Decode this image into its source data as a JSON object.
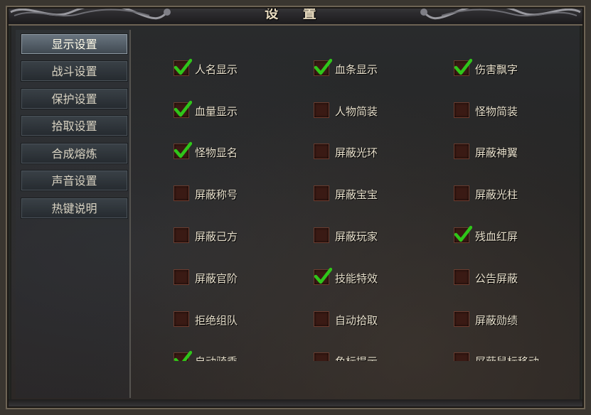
{
  "window": {
    "title": "设 置"
  },
  "tabs": [
    {
      "label": "显示设置",
      "active": true
    },
    {
      "label": "战斗设置",
      "active": false
    },
    {
      "label": "保护设置",
      "active": false
    },
    {
      "label": "拾取设置",
      "active": false
    },
    {
      "label": "合成熔炼",
      "active": false
    },
    {
      "label": "声音设置",
      "active": false
    },
    {
      "label": "热键说明",
      "active": false
    }
  ],
  "options": [
    [
      {
        "label": "人名显示",
        "checked": true
      },
      {
        "label": "血条显示",
        "checked": true
      },
      {
        "label": "伤害飘字",
        "checked": true
      }
    ],
    [
      {
        "label": "血量显示",
        "checked": true
      },
      {
        "label": "人物简装",
        "checked": false
      },
      {
        "label": "怪物简装",
        "checked": false
      }
    ],
    [
      {
        "label": "怪物显名",
        "checked": true
      },
      {
        "label": "屏蔽光环",
        "checked": false
      },
      {
        "label": "屏蔽神翼",
        "checked": false
      }
    ],
    [
      {
        "label": "屏蔽称号",
        "checked": false
      },
      {
        "label": "屏蔽宝宝",
        "checked": false
      },
      {
        "label": "屏蔽光柱",
        "checked": false
      }
    ],
    [
      {
        "label": "屏蔽己方",
        "checked": false
      },
      {
        "label": "屏蔽玩家",
        "checked": false
      },
      {
        "label": "残血红屏",
        "checked": true
      }
    ],
    [
      {
        "label": "屏蔽官阶",
        "checked": false
      },
      {
        "label": "技能特效",
        "checked": true
      },
      {
        "label": "公告屏蔽",
        "checked": false
      }
    ],
    [
      {
        "label": "拒绝组队",
        "checked": false
      },
      {
        "label": "自动拾取",
        "checked": false
      },
      {
        "label": "屏蔽勋绩",
        "checked": false
      }
    ],
    [
      {
        "label": "自动骑乘",
        "checked": true
      },
      {
        "label": "角标提示",
        "checked": false
      },
      {
        "label": "屏蔽鼠标移动",
        "checked": false
      }
    ]
  ],
  "icons": {
    "check": "check-icon",
    "ornament": "dragon-ornament-icon"
  },
  "colors": {
    "check": "#2fc51a",
    "checkbox_bg": "#3a1a14",
    "title": "#e9dcc0"
  }
}
